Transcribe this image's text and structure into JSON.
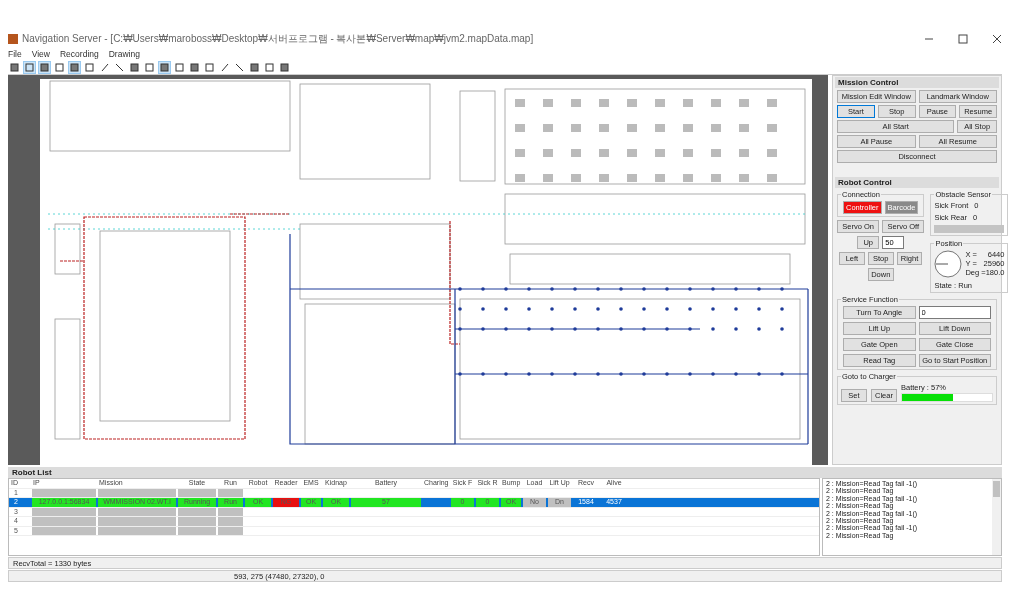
{
  "window": {
    "title": "Navigation Server - [C:₩Users₩maroboss₩Desktop₩서버프로그램 - 복사본₩Server₩map₩jvm2.mapData.map]"
  },
  "menu": [
    "File",
    "View",
    "Recording",
    "Drawing"
  ],
  "toolbar": [
    {
      "pressed": false
    },
    {
      "pressed": true
    },
    {
      "pressed": true
    },
    {
      "pressed": false
    },
    {
      "pressed": true
    },
    {
      "pressed": false
    },
    {
      "pressed": false
    },
    {
      "pressed": false
    },
    {
      "pressed": false
    },
    {
      "pressed": false
    },
    {
      "pressed": true
    },
    {
      "pressed": false
    },
    {
      "pressed": false
    },
    {
      "pressed": false
    },
    {
      "pressed": false
    },
    {
      "pressed": false
    },
    {
      "pressed": false
    },
    {
      "pressed": false
    },
    {
      "pressed": false
    }
  ],
  "mission_control": {
    "title": "Mission Control",
    "rows": [
      [
        {
          "label": "Mission Edit Window",
          "focused": false
        },
        {
          "label": "Landmark Window",
          "focused": false
        }
      ],
      [
        {
          "label": "Start",
          "focused": true
        },
        {
          "label": "Stop",
          "focused": false
        },
        {
          "label": "Pause",
          "focused": false
        },
        {
          "label": "Resume",
          "focused": false
        }
      ],
      [
        {
          "label": "All Start",
          "focused": false
        },
        {
          "label": "All Stop",
          "focused": false
        }
      ],
      [
        {
          "label": "All Pause",
          "focused": false
        },
        {
          "label": "All Resume",
          "focused": false
        }
      ],
      [
        {
          "label": "Disconnect",
          "focused": false
        }
      ]
    ]
  },
  "robot_control": {
    "title": "Robot Control",
    "connection": {
      "title": "Connection",
      "buttons": [
        {
          "label": "Controller",
          "selected": true
        },
        {
          "label": "Barcode",
          "selected": false
        }
      ]
    },
    "servo": [
      "Servo On",
      "Servo Off"
    ],
    "obstacle": {
      "title": "Obstacle Sensor",
      "rows": [
        {
          "label": "Sick Front",
          "value": "0"
        },
        {
          "label": "Sick Rear",
          "value": "0"
        }
      ]
    },
    "jog": {
      "up": "Up",
      "left": "Left",
      "stop": "Stop",
      "right": "Right",
      "down": "Down",
      "speed": "50"
    },
    "position": {
      "title": "Position",
      "rows": [
        {
          "label": "X =",
          "value": "6440"
        },
        {
          "label": "Y =",
          "value": "25960"
        },
        {
          "label": "Deg =",
          "value": "180.0"
        }
      ],
      "state": "State : Run"
    },
    "service": {
      "title": "Service Function",
      "turn_button": "Turn To Angle",
      "angle": "0",
      "buttons": [
        "Lift Up",
        "Lift Down",
        "Gate Open",
        "Gate Close",
        "Read Tag",
        "Go to Start Position"
      ]
    },
    "charger": {
      "title": "Goto to Charger",
      "buttons": [
        "Set",
        "Clear"
      ],
      "battery_label": "Battery : 57%",
      "level": 0.57
    }
  },
  "robot_list": {
    "title": "Robot List",
    "columns": [
      "ID",
      "IP",
      "Mission",
      "State",
      "Run",
      "Robot",
      "Reader",
      "EMS",
      "Kidnap",
      "Battery",
      "Charing",
      "Sick F",
      "Sick R",
      "Bump",
      "Load",
      "Lift Up",
      "Recv",
      "Alive"
    ],
    "rows": [
      {
        "selected": false,
        "cells": [
          "1",
          {
            "color": "#c0c0c0"
          },
          {
            "color": "#c0c0c0"
          },
          {
            "color": "#c0c0c0"
          },
          {
            "color": "#c0c0c0"
          },
          null,
          null,
          null,
          null,
          null,
          null,
          null,
          null,
          null,
          null,
          null,
          null,
          null
        ]
      },
      {
        "selected": true,
        "cells": [
          "2",
          {
            "text": "127.0.0.1:56834",
            "color": "#22e622"
          },
          {
            "text": "WMMISSION 02.WT.I",
            "color": "#22e622"
          },
          {
            "text": "Running",
            "color": "#22e622"
          },
          {
            "text": "Run",
            "color": "#22e622"
          },
          {
            "text": "OK",
            "color": "#22e622"
          },
          {
            "text": "NG",
            "color": "#e81010"
          },
          {
            "text": "OK",
            "color": "#22e622"
          },
          {
            "text": "OK",
            "color": "#22e622"
          },
          {
            "text": "57",
            "color": "#22e622"
          },
          null,
          {
            "text": "0",
            "color": "#22e622"
          },
          {
            "text": "0",
            "color": "#22e622"
          },
          {
            "text": "OK",
            "color": "#22e622"
          },
          {
            "text": "No",
            "color": "#c0c0c0"
          },
          {
            "text": "Dn",
            "color": "#c0c0c0"
          },
          {
            "text": "1584"
          },
          {
            "text": "4537"
          }
        ]
      },
      {
        "selected": false,
        "cells": [
          "3",
          {
            "color": "#c0c0c0"
          },
          {
            "color": "#c0c0c0"
          },
          {
            "color": "#c0c0c0"
          },
          {
            "color": "#c0c0c0"
          },
          null,
          null,
          null,
          null,
          null,
          null,
          null,
          null,
          null,
          null,
          null,
          null,
          null
        ]
      },
      {
        "selected": false,
        "cells": [
          "4",
          {
            "color": "#c0c0c0"
          },
          {
            "color": "#c0c0c0"
          },
          {
            "color": "#c0c0c0"
          },
          {
            "color": "#c0c0c0"
          },
          null,
          null,
          null,
          null,
          null,
          null,
          null,
          null,
          null,
          null,
          null,
          null,
          null
        ]
      },
      {
        "selected": false,
        "cells": [
          "5",
          {
            "color": "#c0c0c0"
          },
          {
            "color": "#c0c0c0"
          },
          {
            "color": "#c0c0c0"
          },
          {
            "color": "#c0c0c0"
          },
          null,
          null,
          null,
          null,
          null,
          null,
          null,
          null,
          null,
          null,
          null,
          null,
          null
        ]
      }
    ]
  },
  "log": [
    "2 : Mission=Read Tag fail -1()",
    "2 : Mission=Read Tag",
    "2 : Mission=Read Tag fail -1()",
    "2 : Mission=Read Tag",
    "2 : Mission=Read Tag fail -1()",
    "2 : Mission=Read Tag",
    "2 : Mission=Read Tag fail -1()",
    "2 : Mission=Read Tag"
  ],
  "recv_total": "RecvTotal = 1330 bytes",
  "status_bar": "593, 275 (47480, 27320), 0"
}
